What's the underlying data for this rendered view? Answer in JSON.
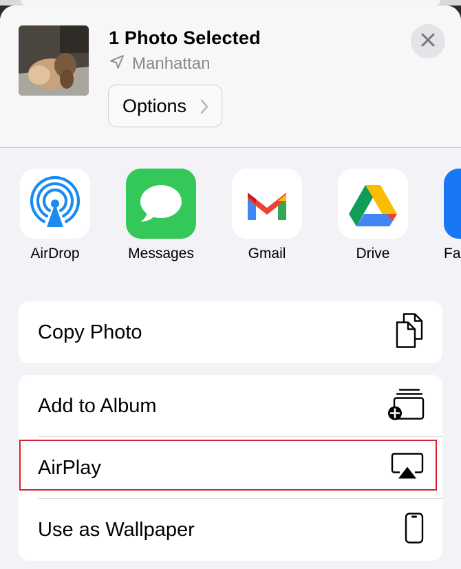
{
  "header": {
    "title": "1 Photo Selected",
    "location": "Manhattan",
    "options_label": "Options"
  },
  "apps": [
    {
      "label": "AirDrop",
      "icon": "airdrop-icon"
    },
    {
      "label": "Messages",
      "icon": "messages-icon"
    },
    {
      "label": "Gmail",
      "icon": "gmail-icon"
    },
    {
      "label": "Drive",
      "icon": "drive-icon"
    },
    {
      "label": "Fa",
      "icon": "facebook-icon"
    }
  ],
  "actions": {
    "copy_photo": "Copy Photo",
    "add_to_album": "Add to Album",
    "airplay": "AirPlay",
    "use_as_wallpaper": "Use as Wallpaper"
  },
  "colors": {
    "highlight": "#d4212d",
    "airdrop_blue": "#1a8cf0",
    "messages_green": "#34c759"
  }
}
